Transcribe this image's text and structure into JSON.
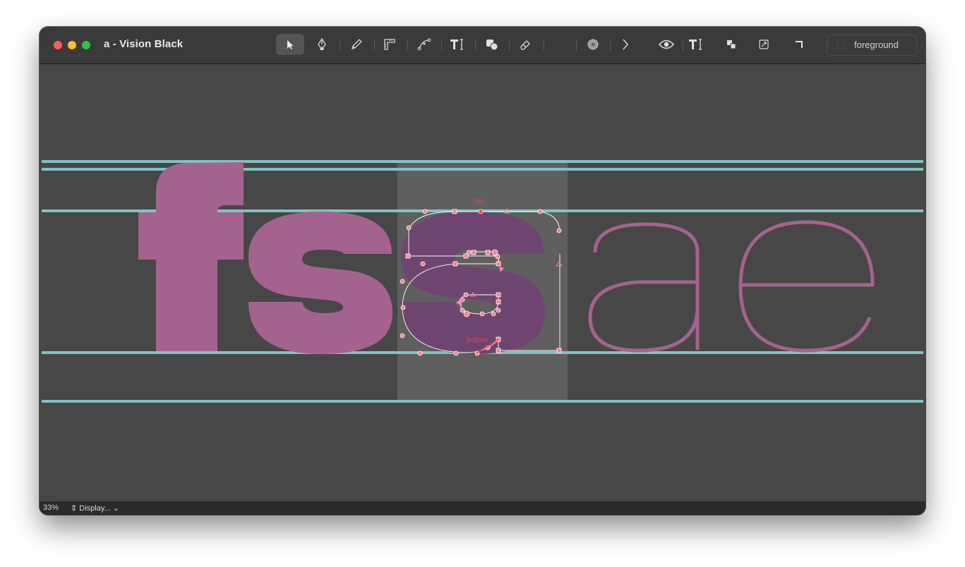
{
  "window": {
    "title": "a - Vision Black"
  },
  "toolbar": {
    "tools": [
      {
        "name": "select-tool",
        "icon": "arrow-pointer-icon",
        "active": true
      },
      {
        "name": "pen-tool",
        "icon": "pen-nib-icon"
      },
      {
        "name": "pencil-tool",
        "icon": "pencil-icon"
      },
      {
        "name": "measure-tool",
        "icon": "ruler-corner-icon"
      },
      {
        "name": "knife-tool",
        "icon": "knife-path-icon"
      },
      {
        "name": "text-tool",
        "icon": "text-cursor-icon"
      },
      {
        "name": "shapes-tool",
        "icon": "shapes-icon"
      },
      {
        "name": "eraser-tool",
        "icon": "eraser-icon"
      },
      {
        "name": "color-tool",
        "icon": "color-wheel-icon"
      },
      {
        "name": "more-tools",
        "icon": "chevron-right-icon"
      },
      {
        "name": "preview-toggle",
        "icon": "eye-icon"
      },
      {
        "name": "text-preview-toggle",
        "icon": "text-cursor-icon"
      },
      {
        "name": "layers-toggle",
        "icon": "layers-icon"
      },
      {
        "name": "component-toggle",
        "icon": "component-icon"
      },
      {
        "name": "corner-toggle",
        "icon": "corner-icon"
      }
    ],
    "layer_label": "foreground"
  },
  "canvas": {
    "glyph_text": "fs",
    "preview_text": "ae",
    "anchor_labels": {
      "top": "top",
      "bottom": "bottom"
    }
  },
  "status": {
    "zoom": "33%",
    "display_label": "Display..."
  },
  "colors": {
    "background": "#474747",
    "metric_line": "#7fc3c6",
    "glyph_fill": "#a4638f",
    "selected_glyph_fill": "#6e4570",
    "active_glyph_bg": "#5f5f5f",
    "node": "#ff7f8c",
    "anchor_label": "#ff3b3b"
  }
}
